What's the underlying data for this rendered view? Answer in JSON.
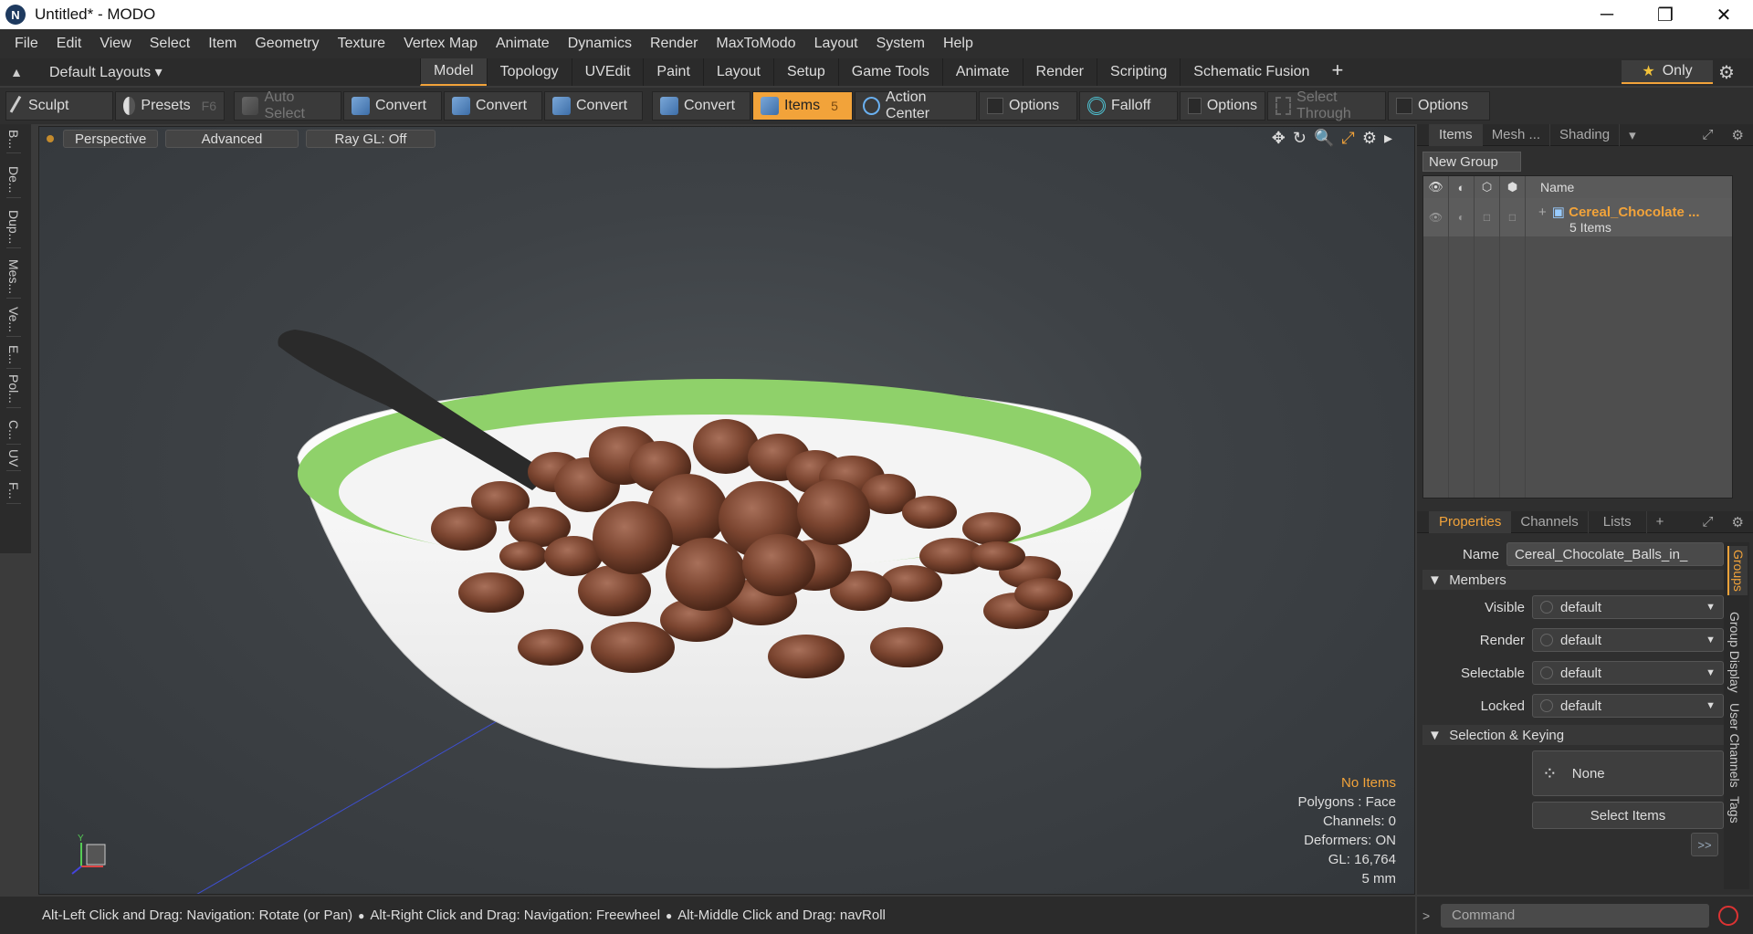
{
  "window": {
    "title": "Untitled* - MODO",
    "app_icon": "N"
  },
  "window_controls": {
    "minimize": "─",
    "maximize": "❐",
    "close": "✕"
  },
  "menu": [
    "File",
    "Edit",
    "View",
    "Select",
    "Item",
    "Geometry",
    "Texture",
    "Vertex Map",
    "Animate",
    "Dynamics",
    "Render",
    "MaxToModo",
    "Layout",
    "System",
    "Help"
  ],
  "layout_bar": {
    "layout_select": "Default Layouts ▾",
    "tabs": [
      "Model",
      "Topology",
      "UVEdit",
      "Paint",
      "Layout",
      "Setup",
      "Game Tools",
      "Animate",
      "Render",
      "Scripting",
      "Schematic Fusion"
    ],
    "active_tab": "Model",
    "add": "+",
    "only_label": "Only",
    "star": "★"
  },
  "toolbar": {
    "sculpt": "Sculpt",
    "presets": "Presets",
    "presets_key": "F6",
    "auto_select": "Auto Select",
    "convert1": "Convert",
    "convert2": "Convert",
    "convert3": "Convert",
    "convert4": "Convert",
    "items": "Items",
    "items_count": "5",
    "action_center": "Action Center",
    "options1": "Options",
    "falloff": "Falloff",
    "options2": "Options",
    "select_through": "Select Through",
    "options3": "Options"
  },
  "left_tabs": [
    "B...",
    "De...",
    "Dup...",
    "Mes...",
    "Ve...",
    "E...",
    "Pol...",
    "C...",
    "UV",
    "F..."
  ],
  "viewport": {
    "view_mode": "Perspective",
    "shading": "Advanced",
    "raygl": "Ray GL: Off",
    "icons": {
      "move": "✥",
      "rotate": "↻",
      "zoom": "🔍",
      "fit": "⤢",
      "settings": "⚙",
      "more": "▸"
    },
    "info": {
      "selection": "No Items",
      "polygons": "Polygons : Face",
      "channels": "Channels: 0",
      "deformers": "Deformers: ON",
      "gl": "GL: 16,764",
      "scale": "5 mm"
    },
    "axis": {
      "y": "Y"
    }
  },
  "items_panel": {
    "tabs": [
      "Items",
      "Mesh ...",
      "Shading"
    ],
    "active_tab": "Items",
    "new_group": "New Group",
    "name_header": "Name",
    "group": {
      "name": "Cereal_Chocolate ...",
      "count": "5 Items"
    }
  },
  "properties_panel": {
    "tabs": [
      "Properties",
      "Channels",
      "Lists"
    ],
    "active_tab": "Properties",
    "name_label": "Name",
    "name_value": "Cereal_Chocolate_Balls_in_",
    "members_header": "Members",
    "visible_label": "Visible",
    "visible_value": "default",
    "render_label": "Render",
    "render_value": "default",
    "selectable_label": "Selectable",
    "selectable_value": "default",
    "locked_label": "Locked",
    "locked_value": "default",
    "selection_header": "Selection & Keying",
    "none_label": "None",
    "select_items": "Select Items",
    "more": ">>",
    "side_tabs": [
      "Groups",
      "Group Display",
      "User Channels",
      "Tags"
    ]
  },
  "status": {
    "hint1": "Alt-Left Click and Drag: Navigation: Rotate (or Pan)",
    "hint2": "Alt-Right Click and Drag: Navigation: Freewheel",
    "hint3": "Alt-Middle Click and Drag: navRoll",
    "bullet": "●"
  },
  "command": {
    "placeholder": "Command",
    "arrow": ">"
  },
  "colors": {
    "accent": "#f2a33a",
    "bowl_rim": "#8fd16a",
    "milk": "#f4f4f4",
    "cereal": "#7b4530"
  }
}
